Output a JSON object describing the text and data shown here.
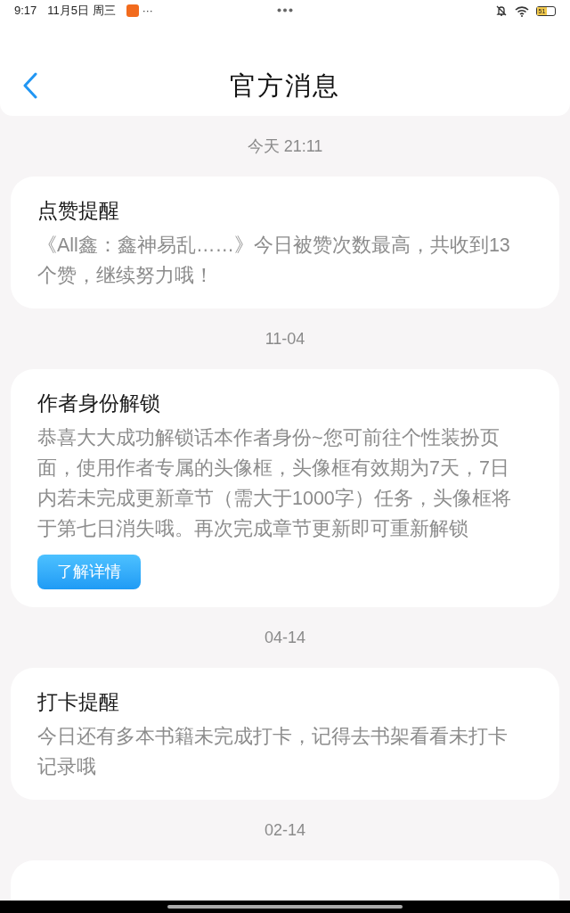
{
  "status_bar": {
    "time": "9:17",
    "date": "11月5日 周三",
    "more": "···",
    "battery": "51"
  },
  "header": {
    "title": "官方消息"
  },
  "groups": [
    {
      "date": "今天 21:11",
      "title": "点赞提醒",
      "body": "《All鑫：鑫神易乱……》今日被赞次数最高，共收到13个赞，继续努力哦！"
    },
    {
      "date": "11-04",
      "title": "作者身份解锁",
      "body": "恭喜大大成功解锁话本作者身份~您可前往个性装扮页面，使用作者专属的头像框，头像框有效期为7天，7日内若未完成更新章节（需大于1000字）任务，头像框将于第七日消失哦。再次完成章节更新即可重新解锁",
      "button": "了解详情"
    },
    {
      "date": "04-14",
      "title": "打卡提醒",
      "body": "今日还有多本书籍未完成打卡，记得去书架看看未打卡记录哦"
    },
    {
      "date": "02-14"
    }
  ]
}
